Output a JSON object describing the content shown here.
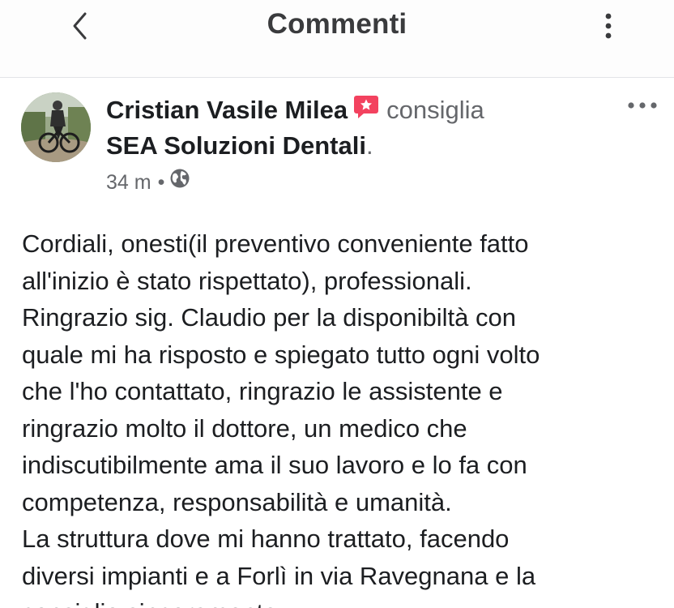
{
  "header": {
    "title": "Commenti",
    "back_icon": "chevron-left-icon",
    "menu_icon": "more-vertical-icon"
  },
  "post": {
    "author": "Cristian Vasile Milea",
    "recommend_icon": "recommend-star-icon",
    "verb": "consiglia",
    "page_name": "SEA Soluzioni Dentali",
    "page_suffix": ".",
    "time": "34 m",
    "separator": "•",
    "audience_icon": "globe-icon",
    "options_icon": "more-horizontal-icon",
    "body_lines": [
      "Cordiali, onesti(il preventivo conveniente fatto",
      "all'inizio è stato rispettato), professionali.",
      "Ringrazio sig. Claudio per la disponibiltà con",
      "quale mi ha risposto e spiegato tutto ogni volto",
      "che l'ho contattato, ringrazio le assistente e",
      "ringrazio molto il dottore, un medico che",
      "indiscutibilmente ama il suo lavoro e lo fa con",
      "competenza, responsabilità e umanità.",
      "La struttura dove mi hanno trattato, facendo",
      "diversi impianti e a Forlì in via Ravegnana e la",
      "consiglio sinceramente."
    ]
  },
  "colors": {
    "primary_text": "#1c1e21",
    "secondary_text": "#65676b",
    "recommend_badge": "#f3425f",
    "header_bg": "#fdfdfd"
  }
}
